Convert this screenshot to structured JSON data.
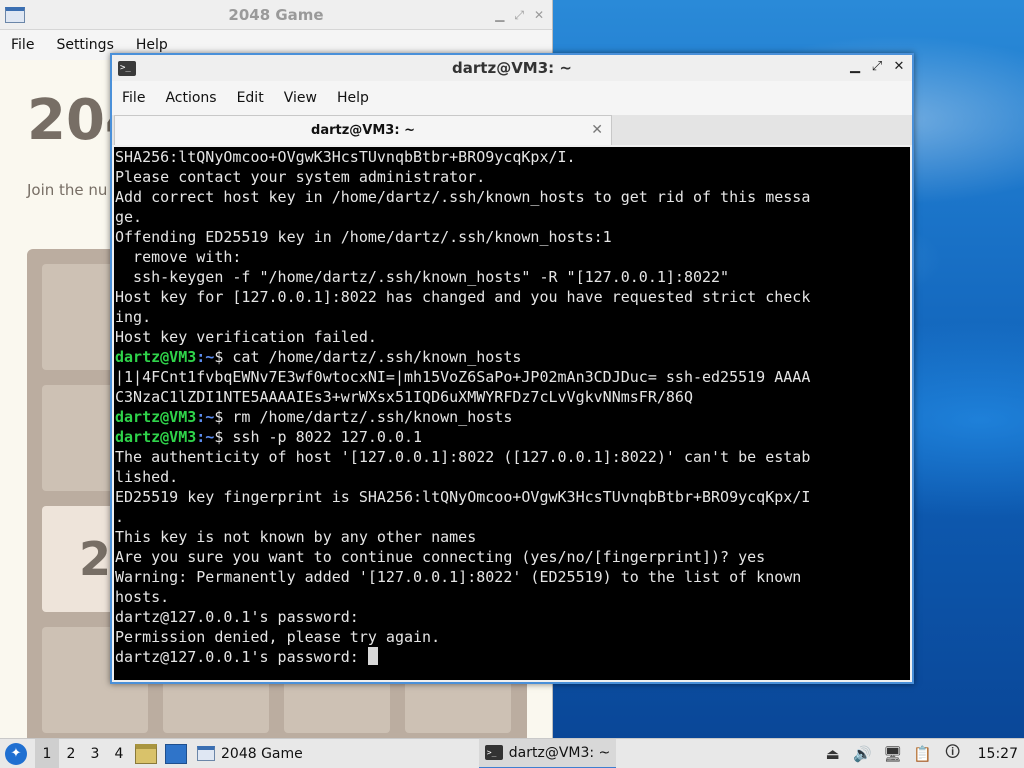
{
  "game_window": {
    "title": "2048 Game",
    "menu": [
      "File",
      "Settings",
      "Help"
    ],
    "heading": "204",
    "intro": "Join the nu",
    "tiles": [
      "",
      "",
      "",
      "",
      "",
      "",
      "",
      "",
      "2",
      "",
      "",
      "",
      "",
      "",
      "",
      "",
      "",
      "",
      "",
      ""
    ]
  },
  "terminal_window": {
    "title": "dartz@VM3: ~",
    "menu": [
      "File",
      "Actions",
      "Edit",
      "View",
      "Help"
    ],
    "tab_label": "dartz@VM3: ~",
    "prompt_user": "dartz@VM3",
    "prompt_path": ":~",
    "lines": [
      {
        "text": "SHA256:ltQNyOmcoo+OVgwK3HcsTUvnqbBtbr+BRO9ycqKpx/I."
      },
      {
        "text": "Please contact your system administrator."
      },
      {
        "text": "Add correct host key in /home/dartz/.ssh/known_hosts to get rid of this messa"
      },
      {
        "text": "ge."
      },
      {
        "text": "Offending ED25519 key in /home/dartz/.ssh/known_hosts:1"
      },
      {
        "text": "  remove with:"
      },
      {
        "text": "  ssh-keygen -f \"/home/dartz/.ssh/known_hosts\" -R \"[127.0.0.1]:8022\""
      },
      {
        "text": "Host key for [127.0.0.1]:8022 has changed and you have requested strict check"
      },
      {
        "text": "ing."
      },
      {
        "text": "Host key verification failed."
      },
      {
        "prompt": true,
        "text": "$ cat /home/dartz/.ssh/known_hosts"
      },
      {
        "text": "|1|4FCnt1fvbqEWNv7E3wf0wtocxNI=|mh15VoZ6SaPo+JP02mAn3CDJDuc= ssh-ed25519 AAAA"
      },
      {
        "text": "C3NzaC1lZDI1NTE5AAAAIEs3+wrWXsx51IQD6uXMWYRFDz7cLvVgkvNNmsFR/86Q"
      },
      {
        "prompt": true,
        "text": "$ rm /home/dartz/.ssh/known_hosts"
      },
      {
        "prompt": true,
        "text": "$ ssh -p 8022 127.0.0.1"
      },
      {
        "text": "The authenticity of host '[127.0.0.1]:8022 ([127.0.0.1]:8022)' can't be estab"
      },
      {
        "text": "lished."
      },
      {
        "text": "ED25519 key fingerprint is SHA256:ltQNyOmcoo+OVgwK3HcsTUvnqbBtbr+BRO9ycqKpx/I"
      },
      {
        "text": "."
      },
      {
        "text": "This key is not known by any other names"
      },
      {
        "text": "Are you sure you want to continue connecting (yes/no/[fingerprint])? yes"
      },
      {
        "text": "Warning: Permanently added '[127.0.0.1]:8022' (ED25519) to the list of known"
      },
      {
        "text": "hosts."
      },
      {
        "text": "dartz@127.0.0.1's password:"
      },
      {
        "text": "Permission denied, please try again."
      },
      {
        "text": "dartz@127.0.0.1's password: ",
        "cursor": true
      }
    ]
  },
  "taskbar": {
    "workspaces": [
      "1",
      "2",
      "3",
      "4"
    ],
    "tasks": [
      {
        "label": "2048 Game",
        "icon": "window-icon",
        "active": false
      },
      {
        "label": "dartz@VM3: ~",
        "icon": "terminal-icon",
        "active": true
      }
    ],
    "clock": "15:27"
  },
  "colors": {
    "prompt_user": "#2fd34a",
    "prompt_path": "#5c8df0",
    "terminal_bg": "#000000",
    "accent": "#4a90d9"
  }
}
